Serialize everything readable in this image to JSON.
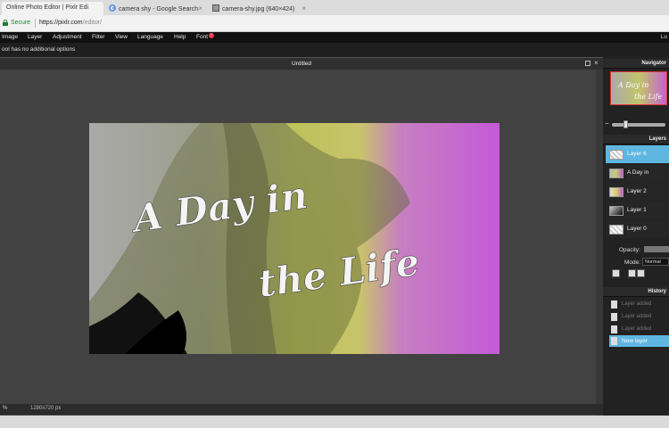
{
  "browser": {
    "tabs": [
      {
        "title": "Online Photo Editor | Pixlr Edi",
        "active": true,
        "icon": "pixlr-icon"
      },
      {
        "title": "camera shy - Google Search",
        "active": false,
        "icon": "google-icon"
      },
      {
        "title": "camera-shy.jpg (640×424)",
        "active": false,
        "icon": "image-icon"
      }
    ],
    "secure_label": "Secure",
    "url_host": "https://pixlr.com",
    "url_path": "/editor/"
  },
  "menu": {
    "items": [
      "Image",
      "Layer",
      "Adjustment",
      "Filter",
      "View",
      "Language",
      "Help",
      "Font"
    ],
    "font_badge": "!",
    "login_label": "Lo"
  },
  "options_bar": {
    "text": "ool has no additional options"
  },
  "document": {
    "title": "Untitled",
    "status_zoom": "%",
    "status_dimensions": "1280x720 px",
    "canvas_text_line1": "A Day in",
    "canvas_text_line2": "the Life"
  },
  "navigator": {
    "title": "Navigator",
    "thumb_text_line1": "A Day in",
    "thumb_text_line2": "the Life",
    "zoom_minus": "−"
  },
  "layers": {
    "title": "Layers",
    "items": [
      {
        "name": "Layer 6",
        "selected": true,
        "thumb": "transparent"
      },
      {
        "name": "A Day in",
        "selected": false,
        "thumb": "text"
      },
      {
        "name": "Layer 2",
        "selected": false,
        "thumb": "gradient"
      },
      {
        "name": "Layer 1",
        "selected": false,
        "thumb": "photo"
      },
      {
        "name": "Layer 0",
        "selected": false,
        "thumb": "transparent"
      }
    ],
    "opacity_label": "Opacity:",
    "mode_label": "Mode:",
    "mode_value": "Normal"
  },
  "history": {
    "title": "History",
    "items": [
      {
        "label": "Layer added",
        "selected": false
      },
      {
        "label": "Layer added",
        "selected": false
      },
      {
        "label": "Layer added",
        "selected": false
      },
      {
        "label": "New layer",
        "selected": true
      }
    ]
  },
  "colors": {
    "accent": "#5fb6e0",
    "magenta": "#c35ad8",
    "yellow_green": "#c9cf6a"
  }
}
